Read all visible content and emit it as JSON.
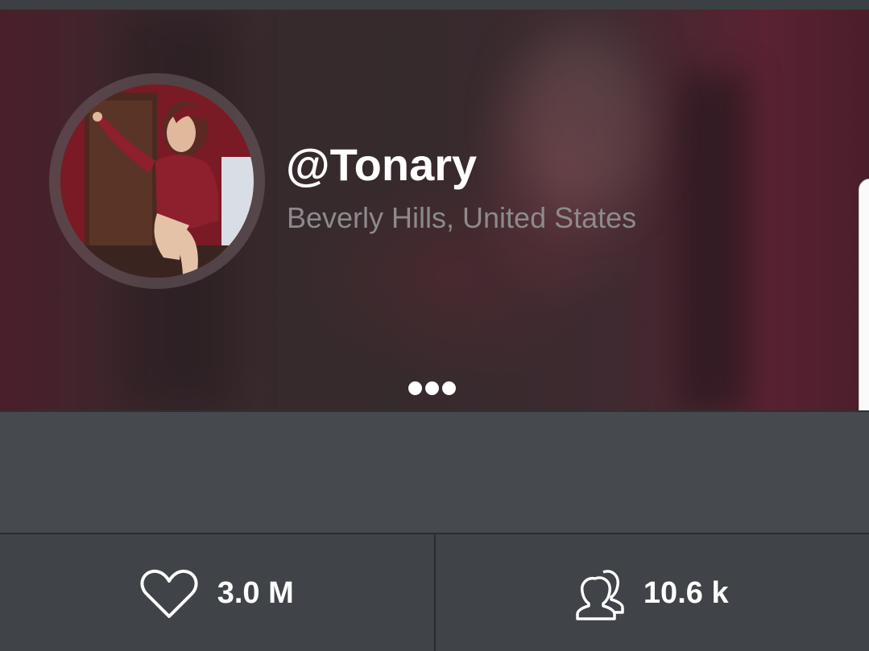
{
  "profile": {
    "username": "@Tonary",
    "location": "Beverly Hills, United States",
    "avatar_icon": "profile-photo",
    "banner_pagination": {
      "pages": 3
    }
  },
  "stats": {
    "likes": {
      "icon": "heart-icon",
      "value": "3.0 M"
    },
    "followers": {
      "icon": "users-icon",
      "value": "10.6 k"
    }
  },
  "colors": {
    "banner": "#3a2a2e",
    "panel": "#46494d",
    "stats_bar": "#404347",
    "text_primary": "#ffffff",
    "text_secondary": "#8d8a8c"
  }
}
